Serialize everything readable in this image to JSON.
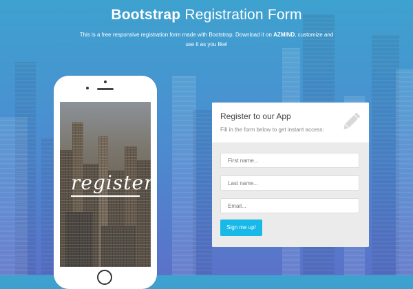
{
  "hero": {
    "title_bold": "Bootstrap",
    "title_light": "Registration Form",
    "desc_1": "This is a free responsive registration form made with Bootstrap. Download it on ",
    "desc_brand": "AZMIND",
    "desc_2": ", customize and use it as you like!"
  },
  "phone": {
    "screen_word": "register"
  },
  "form": {
    "title": "Register to our App",
    "subtitle": "Fill in the form below to get instant access:",
    "first_name_placeholder": "First name...",
    "last_name_placeholder": "Last name...",
    "email_placeholder": "Email...",
    "submit_label": "Sign me up!",
    "icon": "pencil-icon"
  },
  "colors": {
    "accent": "#19b9e7",
    "bg_top": "#3ea2cf",
    "bg_bottom": "#5a72c9"
  }
}
